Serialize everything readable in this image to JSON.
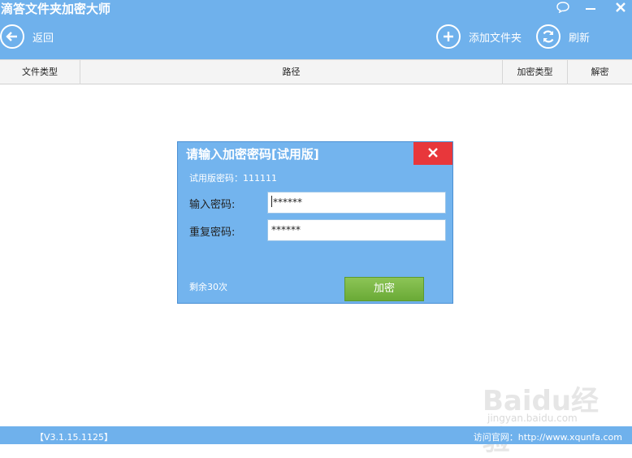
{
  "app": {
    "title": "滴答文件夹加密大师"
  },
  "toolbar": {
    "back_label": "返回",
    "add_folder_label": "添加文件夹",
    "refresh_label": "刷新"
  },
  "table": {
    "columns": [
      "文件类型",
      "路径",
      "加密类型",
      "解密"
    ]
  },
  "dialog": {
    "title": "请输入加密密码[试用版]",
    "trial_hint": "试用版密码：111111",
    "password_label": "输入密码:",
    "password_value": "******",
    "repeat_label": "重复密码:",
    "repeat_value": "******",
    "remaining": "剩余30次",
    "encrypt_button": "加密"
  },
  "footer": {
    "version": "【V3.1.15.1125】",
    "website": "访问官网：http://www.xqunfa.com"
  },
  "watermark": {
    "logo": "Baidu经验",
    "url": "jingyan.baidu.com"
  },
  "colors": {
    "primary": "#6fb1ec",
    "close": "#e8373b",
    "button": "#7ab846"
  },
  "icons": [
    "chat-icon",
    "minimize-icon",
    "close-icon",
    "back-arrow-icon",
    "add-circle-icon",
    "refresh-icon"
  ]
}
